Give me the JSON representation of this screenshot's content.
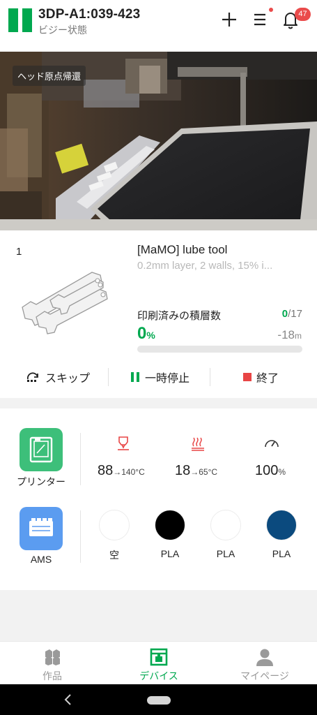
{
  "header": {
    "title": "3DP-A1:039-423",
    "subtitle": "ビジー状態",
    "notification_count": "47"
  },
  "camera": {
    "overlay_label": "ヘッド原点帰還"
  },
  "job": {
    "plate_number": "1",
    "name": "[MaMO] lube tool",
    "description": "0.2mm layer, 2 walls, 15% i...",
    "layers_label": "印刷済みの積層数",
    "layers_current": "0",
    "layers_total": "/17",
    "progress_value": "0",
    "progress_unit": "%",
    "progress_fraction": 0,
    "remaining_value": "-18",
    "remaining_unit": "m",
    "controls": {
      "skip_label": "スキップ",
      "pause_label": "一時停止",
      "stop_label": "終了"
    }
  },
  "status": {
    "printer_label": "プリンター",
    "nozzle_temp": "88",
    "nozzle_target": "→140°C",
    "bed_temp": "18",
    "bed_target": "→65°C",
    "speed_value": "100",
    "speed_unit": "%",
    "ams_label": "AMS",
    "spools": [
      {
        "label": "空",
        "color": "#ffffff"
      },
      {
        "label": "PLA",
        "color": "#000000"
      },
      {
        "label": "PLA",
        "color": "#ffffff"
      },
      {
        "label": "PLA",
        "color": "#0b4a7e"
      }
    ]
  },
  "tabs": {
    "works_label": "作品",
    "devices_label": "デバイス",
    "mypage_label": "マイページ"
  },
  "colors": {
    "accent": "#00a84f",
    "printer_tile": "#3dbf7a",
    "ams_tile": "#5b9cf0",
    "badge": "#ea4b4b",
    "stop": "#e84545"
  }
}
